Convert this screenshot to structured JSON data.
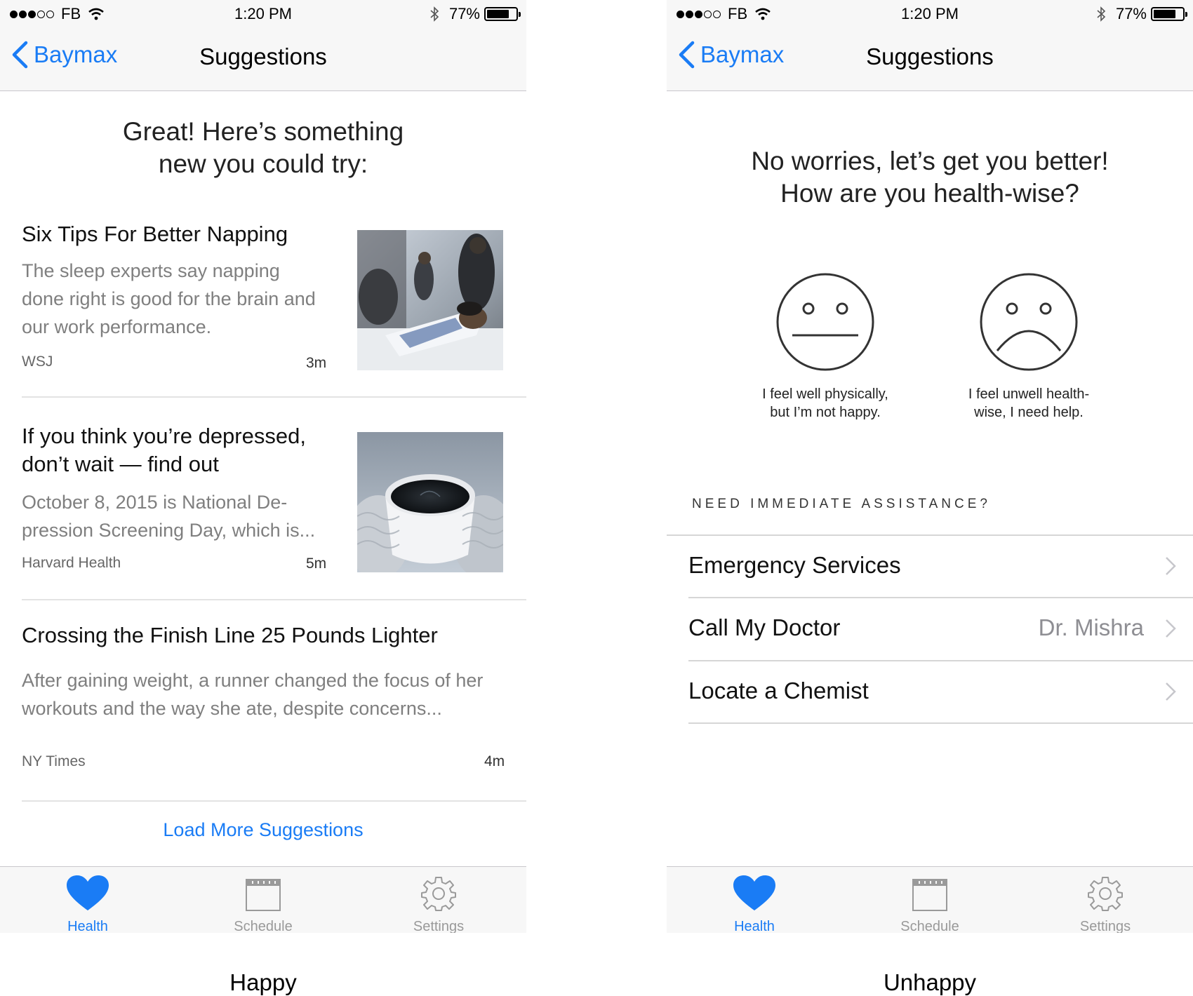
{
  "status": {
    "carrier": "FB",
    "time": "1:20 PM",
    "battery": "77%",
    "battery_level": 0.77
  },
  "nav": {
    "back_label": "Baymax",
    "title": "Suggestions"
  },
  "tabs": [
    {
      "label": "Health",
      "icon": "heart-icon",
      "active": true
    },
    {
      "label": "Schedule",
      "icon": "calendar-icon",
      "active": false
    },
    {
      "label": "Settings",
      "icon": "gear-icon",
      "active": false
    }
  ],
  "happy": {
    "caption": "Happy",
    "headline_line1": "Great! Here’s something",
    "headline_line2": "new you could try:",
    "articles": [
      {
        "title_line1": "Six Tips For Better Napping",
        "title_line2": "",
        "desc_line1": "The sleep experts say napping",
        "desc_line2": "done right is good for the brain and",
        "desc_line3": "our work performance.",
        "source": "WSJ",
        "time": "3m",
        "image": "person-napping-photo"
      },
      {
        "title_line1": "If you think you’re depressed,",
        "title_line2": "don’t wait — find out",
        "desc_line1": "October 8, 2015 is National De-",
        "desc_line2": "pression Screening Day, which is...",
        "desc_line3": "",
        "source": "Harvard Health",
        "time": "5m",
        "image": "coffee-cup-photo"
      },
      {
        "title_line1": "Crossing the Finish Line 25 Pounds Lighter",
        "title_line2": "",
        "desc_line1": "After gaining weight, a runner changed the focus of her",
        "desc_line2": "workouts and the way she ate, despite concerns...",
        "desc_line3": "",
        "source": "NY Times",
        "time": "4m",
        "image": ""
      }
    ],
    "load_more": "Load More Suggestions"
  },
  "unhappy": {
    "caption": "Unhappy",
    "headline_line1": "No worries, let’s get you better!",
    "headline_line2": "How are you health-wise?",
    "options": [
      {
        "label_line1": "I feel well physically,",
        "label_line2": "but I’m not happy.",
        "icon": "neutral-face-icon"
      },
      {
        "label_line1": "I feel unwell health-",
        "label_line2": "wise, I need help.",
        "icon": "sad-face-icon"
      }
    ],
    "section_title": "NEED IMMEDIATE ASSISTANCE?",
    "rows": [
      {
        "label": "Emergency Services",
        "value": ""
      },
      {
        "label": "Call My Doctor",
        "value": "Dr. Mishra"
      },
      {
        "label": "Locate a Chemist",
        "value": ""
      }
    ]
  },
  "colors": {
    "accent": "#1a7cf5",
    "bar_bg": "#f7f7f7",
    "secondary_text": "#7f7f7f"
  }
}
